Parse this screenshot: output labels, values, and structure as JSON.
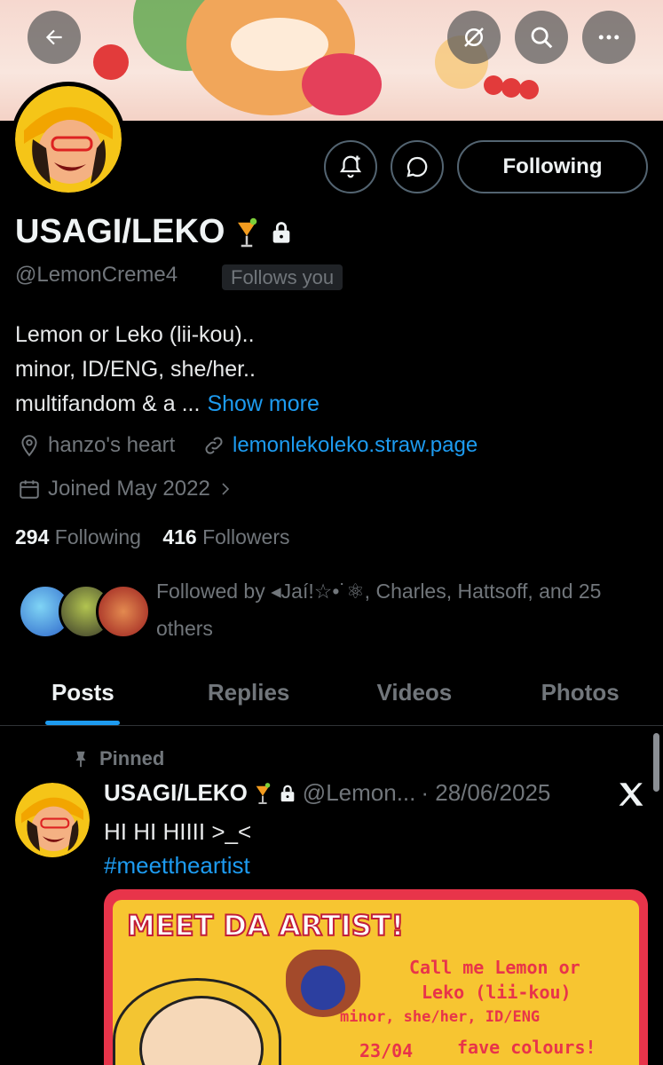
{
  "profile": {
    "name": "USAGI/LEKO",
    "handle": "@LemonCreme4",
    "follows_you": "Follows you",
    "bio_lines": [
      "Lemon or Leko (lii-kou)..",
      "minor, ID/ENG, she/her..",
      "multifandom & a ..."
    ],
    "show_more": "Show more",
    "location": "hanzo's heart",
    "website": "lemonlekoleko.straw.page",
    "joined": "Joined May 2022",
    "following_count": "294",
    "following_label": "Following",
    "followers_count": "416",
    "followers_label": "Followers",
    "followed_by": "Followed by ◂Jaí!☆•˙⚛, Charles, Hattsoff, and 25 others"
  },
  "actions": {
    "following_button": "Following"
  },
  "tabs": [
    "Posts",
    "Replies",
    "Videos",
    "Photos"
  ],
  "pinned_post": {
    "pinned_label": "Pinned",
    "author_name": "USAGI/LEKO",
    "author_handle": "@Lemon...",
    "date": "· 28/06/2025",
    "text": "HI HI HIIII >_<",
    "hashtag": "#meettheartist",
    "image_text": {
      "title": "MEET DA ARTIST!",
      "line1": "Call me Lemon or",
      "line2": "Leko (lii-kou)",
      "line3": "minor, she/her, ID/ENG",
      "date": "23/04",
      "fave": "fave colours!"
    }
  },
  "icons": [
    "back-arrow-icon",
    "hide-icon",
    "search-icon",
    "more-icon",
    "notification-bell-icon",
    "message-icon",
    "lock-icon",
    "location-icon",
    "link-icon",
    "calendar-icon",
    "chevron-right-icon",
    "pin-icon",
    "x-logo-icon"
  ],
  "colors": {
    "accent": "#1d9bf0",
    "background": "#000000",
    "muted": "#71767b"
  }
}
